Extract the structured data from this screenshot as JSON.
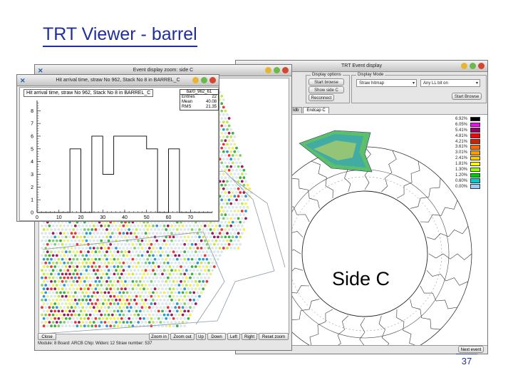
{
  "slide": {
    "title": "TRT Viewer - barrel",
    "page_number": "37"
  },
  "main_window": {
    "title": "TRT Event display",
    "display_options_label": "Display options",
    "display_mode_label": "Display Mode",
    "start_browse_button": "Start browse",
    "show_side_button": "Show side C",
    "reconnect_button": "Reconnect",
    "mode_select": "Straw hitmap",
    "lb_select": "Any LL bit on",
    "start_browse_right": "Start Browse",
    "tabs": [
      "Idb",
      "Endcap C"
    ],
    "side_label": "Side C",
    "legend": [
      {
        "value": "6.92%",
        "color": "#000000"
      },
      {
        "value": "6.05%",
        "color": "#ff00ff"
      },
      {
        "value": "5.41%",
        "color": "#990066"
      },
      {
        "value": "4.81%",
        "color": "#ff0000"
      },
      {
        "value": "4.21%",
        "color": "#cc2200"
      },
      {
        "value": "3.61%",
        "color": "#ff6600"
      },
      {
        "value": "3.01%",
        "color": "#ff9900"
      },
      {
        "value": "2.41%",
        "color": "#ffcc00"
      },
      {
        "value": "1.81%",
        "color": "#ffff00"
      },
      {
        "value": "1.30%",
        "color": "#99ff00"
      },
      {
        "value": "1.20%",
        "color": "#00cc00"
      },
      {
        "value": "0.60%",
        "color": "#00cccc"
      },
      {
        "value": "0.00%",
        "color": "#99ccff"
      }
    ],
    "next_button": "Next event"
  },
  "zoom_window": {
    "title": "Event display zoom: side C",
    "buttons": {
      "close": "Close",
      "zoom_in": "Zoom in",
      "zoom_out": "Zoom out",
      "up": "Up",
      "down": "Down",
      "left": "Left",
      "right": "Right",
      "reset": "Reset zoom"
    },
    "status_text": "Module: 8  Board: ARCB  Chip: Widerc  12 Straw number: 537"
  },
  "hist_window": {
    "title": "Hit arrival time, straw No 962, Stack No 8 in BARREL_C",
    "plot_title": "Hit arrival time, straw No 962, Stack No 8 in BARREL_C",
    "stats": {
      "name": "bar0_962_61",
      "entries_label": "Entries",
      "entries": "22",
      "mean_label": "Mean",
      "mean": "40.08",
      "rms_label": "RMS",
      "rms": "21.35"
    }
  },
  "chart_data": {
    "type": "bar",
    "title": "Hit arrival time, straw No 962, Stack No 8 in BARREL_C",
    "x_ticks": [
      "0",
      "10",
      "20",
      "30",
      "40",
      "50",
      "60",
      "70"
    ],
    "y_ticks": [
      "0",
      "1",
      "2",
      "3",
      "4",
      "5",
      "6",
      "7",
      "8"
    ],
    "xlim": [
      0,
      80
    ],
    "ylim": [
      0,
      8.8
    ],
    "bin_edges": [
      0,
      5,
      10,
      15,
      20,
      25,
      30,
      35,
      40,
      45,
      50,
      55,
      60,
      65,
      70,
      75,
      80
    ],
    "values": [
      0,
      0,
      0,
      5,
      0,
      6,
      3,
      6,
      6,
      6,
      5,
      0,
      5,
      0,
      0,
      0
    ]
  }
}
